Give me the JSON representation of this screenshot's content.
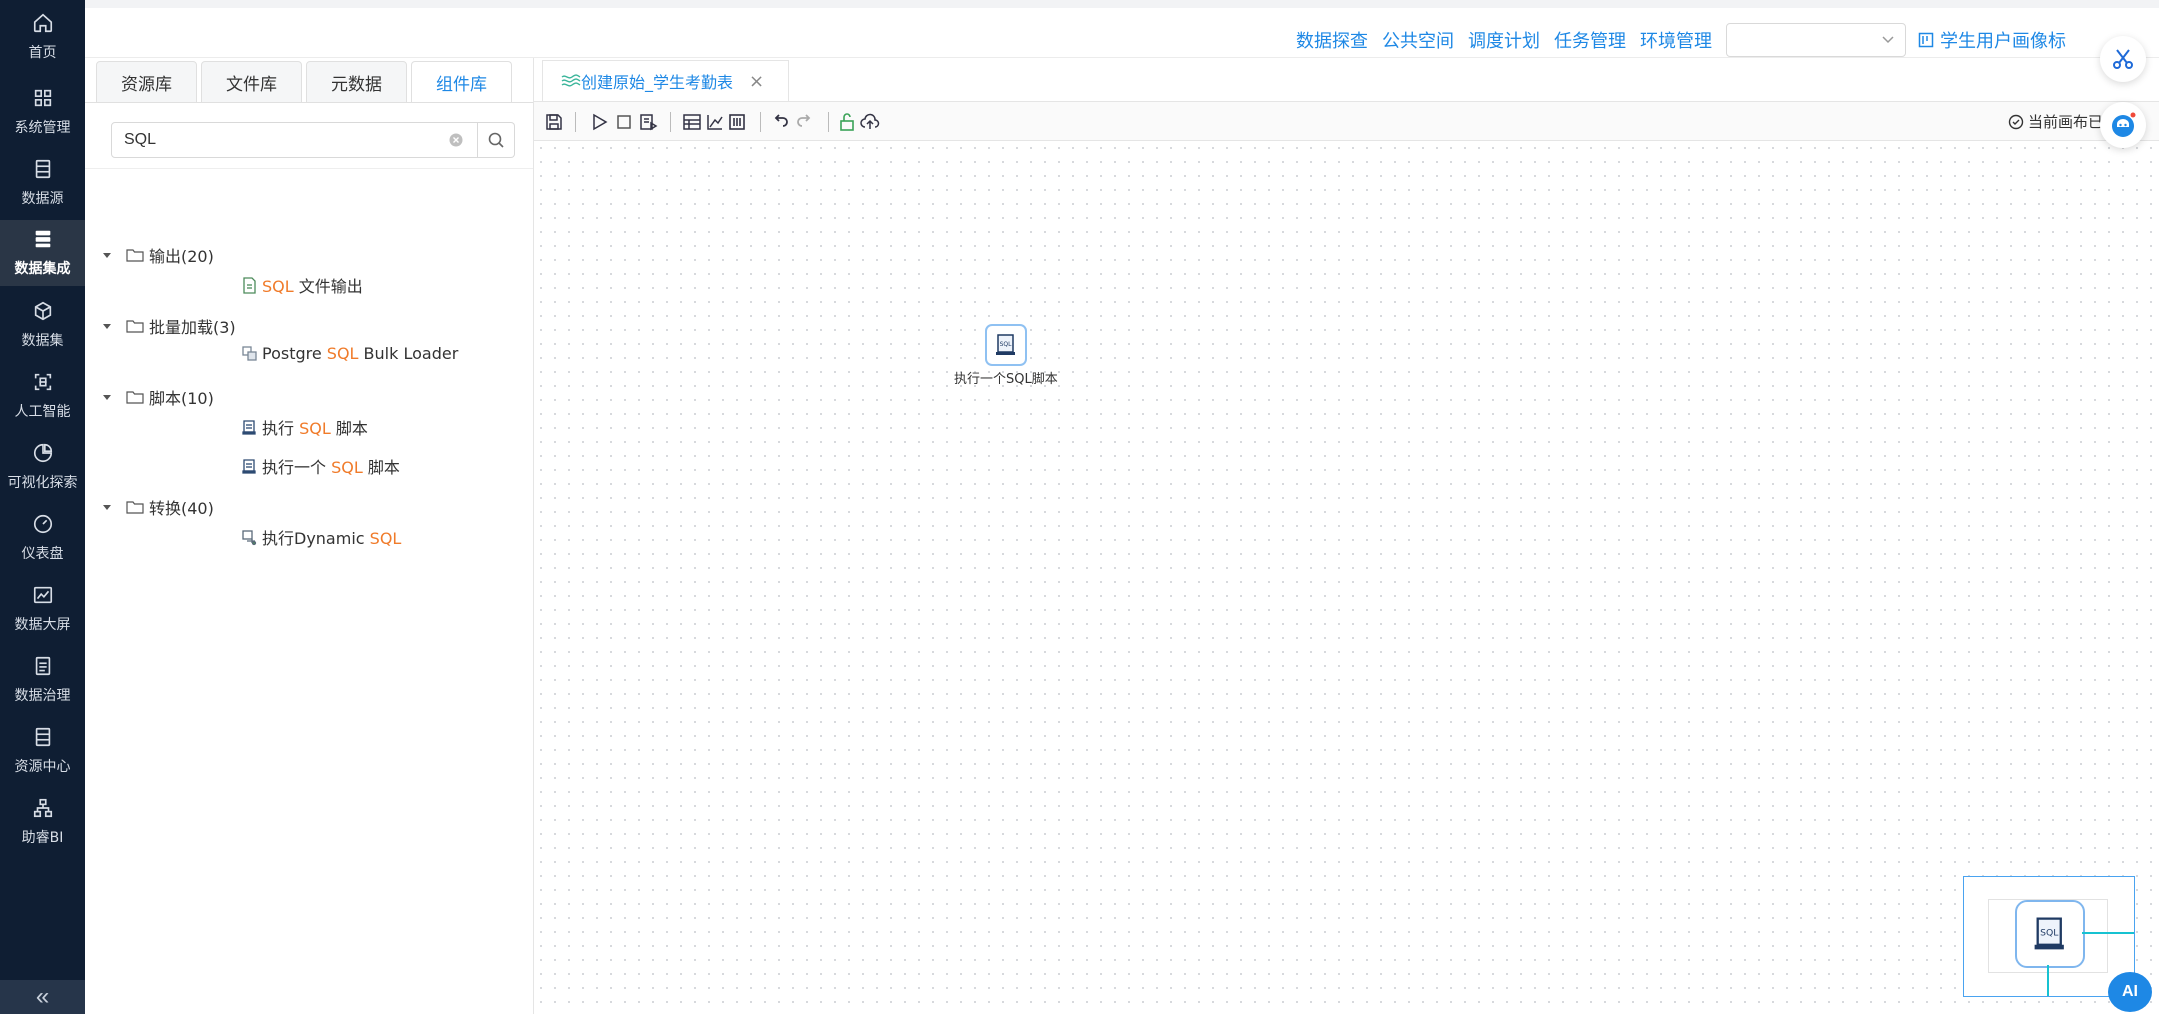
{
  "sidebar": {
    "items": [
      {
        "label": "首页",
        "icon": "home-icon"
      },
      {
        "label": "系统管理",
        "icon": "grid-icon"
      },
      {
        "label": "数据源",
        "icon": "database-icon"
      },
      {
        "label": "数据集成",
        "icon": "integration-icon",
        "active": true
      },
      {
        "label": "数据集",
        "icon": "cube-icon"
      },
      {
        "label": "人工智能",
        "icon": "ai-scan-icon"
      },
      {
        "label": "可视化探索",
        "icon": "pie-chart-icon"
      },
      {
        "label": "仪表盘",
        "icon": "gauge-icon"
      },
      {
        "label": "数据大屏",
        "icon": "line-chart-icon"
      },
      {
        "label": "数据治理",
        "icon": "document-icon"
      },
      {
        "label": "资源中心",
        "icon": "resource-icon"
      },
      {
        "label": "助睿BI",
        "icon": "org-chart-icon"
      }
    ],
    "collapse_label": "«"
  },
  "header": {
    "links": [
      "数据探查",
      "公共空间",
      "调度计划",
      "任务管理",
      "环境管理"
    ],
    "env_select_value": "",
    "user_label": "学生用户画像标"
  },
  "left_panel": {
    "tabs": [
      "资源库",
      "文件库",
      "元数据",
      "组件库"
    ],
    "active_tab": 3,
    "search": {
      "value": "SQL",
      "placeholder": ""
    },
    "tree": {
      "groups": [
        {
          "label": "输出(20)",
          "children": [
            {
              "parts": [
                "",
                "SQL",
                " 文件输出"
              ]
            }
          ]
        },
        {
          "label": "批量加载(3)",
          "children": [
            {
              "parts": [
                "Postgre ",
                "SQL",
                " Bulk Loader"
              ]
            }
          ]
        },
        {
          "label": "脚本(10)",
          "children": [
            {
              "parts": [
                "执行 ",
                "SQL",
                " 脚本"
              ]
            },
            {
              "parts": [
                "执行一个 ",
                "SQL",
                " 脚本"
              ]
            }
          ]
        },
        {
          "label": "转换(40)",
          "children": [
            {
              "parts": [
                "执行Dynamic ",
                "SQL",
                ""
              ]
            }
          ]
        }
      ]
    }
  },
  "editor": {
    "tab_title": "创建原始_学生考勤表",
    "tab_close": "×",
    "status_text": "当前画布已",
    "step_label": "执行一个SQL脚本",
    "step_icon_text": "SQL",
    "minimap_icon_text": "SQL"
  },
  "floating": {
    "ai_label": "AI"
  },
  "colors": {
    "accent": "#1e88e5",
    "highlight": "#f07b2a",
    "sidebar_bg": "#0f1e33"
  }
}
